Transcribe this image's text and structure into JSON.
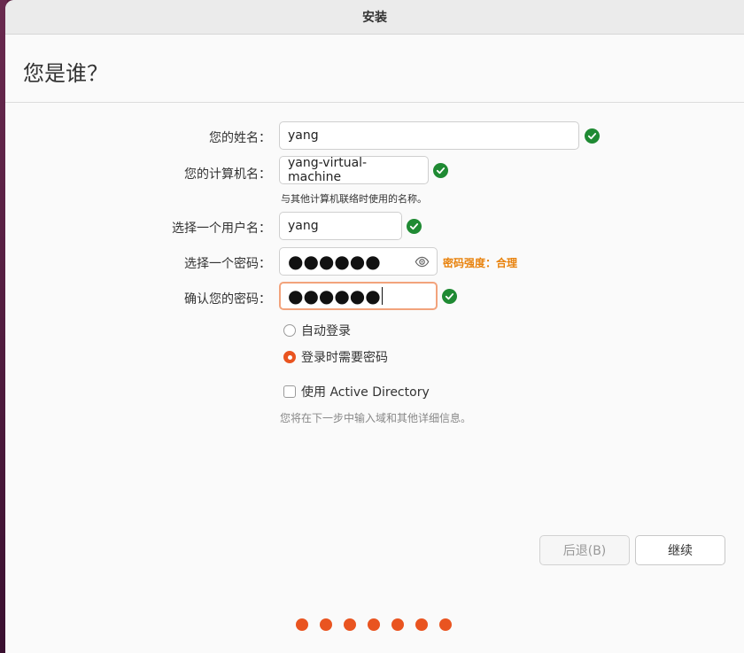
{
  "window": {
    "title": "安装"
  },
  "page": {
    "title": "您是谁？"
  },
  "form": {
    "name": {
      "label": "您的姓名：",
      "value": "yang"
    },
    "computer": {
      "label": "您的计算机名：",
      "value": "yang-virtual-machine",
      "hint": "与其他计算机联络时使用的名称。"
    },
    "username": {
      "label": "选择一个用户名：",
      "value": "yang"
    },
    "password": {
      "label": "选择一个密码：",
      "value": "●●●●●●",
      "strength": "密码强度：合理"
    },
    "confirm": {
      "label": "确认您的密码：",
      "value": "●●●●●●"
    }
  },
  "login_options": {
    "auto_login": "自动登录",
    "require_password": "登录时需要密码",
    "selected": "require_password"
  },
  "active_directory": {
    "label": "使用 Active Directory",
    "checked": false,
    "hint": "您将在下一步中输入域和其他详细信息。"
  },
  "buttons": {
    "back": "后退(B)",
    "next": "继续"
  },
  "progress": {
    "total_steps": 7
  },
  "colors": {
    "accent": "#E95420",
    "valid": "#1F8A33",
    "strength": "#E8820C"
  },
  "icons": {
    "valid": "check-circle-icon",
    "reveal": "eye-icon"
  }
}
